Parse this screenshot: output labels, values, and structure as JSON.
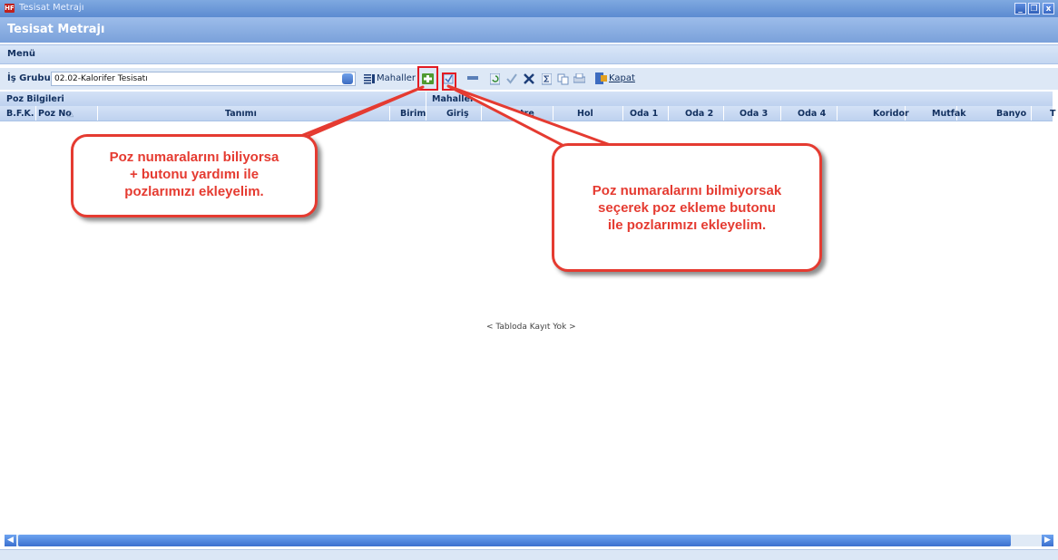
{
  "window": {
    "app_icon_text": "HF",
    "title": "Tesisat Metrajı",
    "minimize_glyph": "_",
    "restore_glyph": "❐",
    "close_glyph": "x"
  },
  "header": {
    "title": "Tesisat Metrajı"
  },
  "menu": {
    "label": "Menü"
  },
  "toolbar": {
    "is_grubu_label": "İş Grubu",
    "is_grubu_value": "02.02-Kalorifer Tesisatı",
    "mahaller_label": "Mahaller",
    "kapat_label": "Kapat",
    "icons": [
      "dropdown-icon",
      "mahaller-icon",
      "add-poz-icon",
      "select-poz-icon",
      "minus-icon",
      "refresh-icon",
      "check-icon",
      "delete-icon",
      "sum-icon",
      "copy-icon",
      "print-icon",
      "exit-icon"
    ]
  },
  "grid": {
    "group_left": "Poz Bilgileri",
    "group_right": "Mahaller",
    "columns": [
      "B.F.K.",
      "Poz No",
      "Tanımı",
      "Birim",
      "Giriş",
      "Antre",
      "Hol",
      "Oda 1",
      "Oda 2",
      "Oda 3",
      "Oda 4",
      "Koridor",
      "Mutfak",
      "Banyo",
      "T"
    ],
    "empty_text": "< Tabloda Kayıt Yok >"
  },
  "callouts": {
    "left": [
      "Poz numaralarını biliyorsa",
      "+ butonu yardımı ile",
      "pozlarımızı ekleyelim."
    ],
    "right": [
      "Poz numaralarını bilmiyorsak",
      "seçerek poz ekleme butonu",
      "ile pozlarımızı ekleyelim."
    ]
  },
  "colors": {
    "callout_red": "#e53b31",
    "titlebar_blue": "#5c8bd1",
    "highlight_red": "#e31b23"
  }
}
